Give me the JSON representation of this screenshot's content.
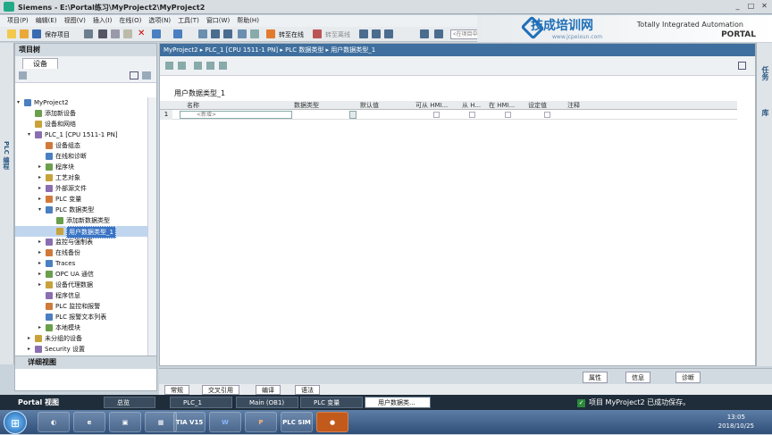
{
  "window": {
    "app": "Siemens",
    "title": "E:\\Portal练习\\MyProject2\\MyProject2"
  },
  "menu": [
    "项目(P)",
    "编辑(E)",
    "视图(V)",
    "插入(I)",
    "在线(O)",
    "选项(N)",
    "工具(T)",
    "窗口(W)",
    "帮助(H)"
  ],
  "toolbar": {
    "save_label": "保存项目",
    "go_online": "转至在线",
    "go_offline": "转至离线",
    "search_placeholder": "<在项目中搜索>"
  },
  "brand": {
    "line1": "Totally Integrated Automation",
    "line2": "PORTAL"
  },
  "watermark": {
    "cn": "技成培训网",
    "url": "www.jcpeixun.com"
  },
  "project_tree": {
    "header": "项目树",
    "tab": "设备",
    "side_label": "PLC 编程",
    "items": [
      {
        "label": "MyProject2",
        "level": 0,
        "arrow": "▾"
      },
      {
        "label": "添加新设备",
        "level": 1,
        "arrow": ""
      },
      {
        "label": "设备和网络",
        "level": 1,
        "arrow": ""
      },
      {
        "label": "PLC_1 [CPU 1511-1 PN]",
        "level": 1,
        "arrow": "▾"
      },
      {
        "label": "设备组态",
        "level": 2,
        "arrow": ""
      },
      {
        "label": "在线和诊断",
        "level": 2,
        "arrow": ""
      },
      {
        "label": "程序块",
        "level": 2,
        "arrow": "▸"
      },
      {
        "label": "工艺对象",
        "level": 2,
        "arrow": "▸"
      },
      {
        "label": "外部源文件",
        "level": 2,
        "arrow": "▸"
      },
      {
        "label": "PLC 变量",
        "level": 2,
        "arrow": "▸"
      },
      {
        "label": "PLC 数据类型",
        "level": 2,
        "arrow": "▾"
      },
      {
        "label": "添加新数据类型",
        "level": 3,
        "arrow": ""
      },
      {
        "label": "用户数据类型_1",
        "level": 3,
        "arrow": "",
        "selected": true
      },
      {
        "label": "监控与强制表",
        "level": 2,
        "arrow": "▸"
      },
      {
        "label": "在线备份",
        "level": 2,
        "arrow": "▸"
      },
      {
        "label": "Traces",
        "level": 2,
        "arrow": "▸"
      },
      {
        "label": "OPC UA 通信",
        "level": 2,
        "arrow": "▸"
      },
      {
        "label": "设备代理数据",
        "level": 2,
        "arrow": "▸"
      },
      {
        "label": "程序信息",
        "level": 2,
        "arrow": ""
      },
      {
        "label": "PLC 监控和报警",
        "level": 2,
        "arrow": ""
      },
      {
        "label": "PLC 报警文本列表",
        "level": 2,
        "arrow": ""
      },
      {
        "label": "本地模块",
        "level": 2,
        "arrow": "▸"
      },
      {
        "label": "未分组的设备",
        "level": 1,
        "arrow": "▸"
      },
      {
        "label": "Security 设置",
        "level": 1,
        "arrow": "▸"
      }
    ]
  },
  "detail_view": {
    "header": "详细视图"
  },
  "editor": {
    "breadcrumb": "MyProject2 ▸ PLC_1 [CPU 1511-1 PN] ▸ PLC 数据类型 ▸ 用户数据类型_1",
    "title": "用户数据类型_1",
    "columns": [
      "名称",
      "数据类型",
      "默认值",
      "可从 HMI...",
      "从 H...",
      "在 HMI...",
      "设定值",
      "注释"
    ],
    "rows": [
      {
        "num": "1",
        "name_placeholder": "<新增>"
      }
    ]
  },
  "right_tabs": [
    "任务",
    "库"
  ],
  "inspector_tabs": [
    "属性",
    "信息",
    "诊断"
  ],
  "general_tabs": [
    "常规",
    "交叉引用",
    "编译",
    "语法"
  ],
  "portal_bar": {
    "portal_view": "Portal 视图",
    "tasks": [
      "总览",
      "PLC_1",
      "Main (OB1)",
      "PLC 变量",
      "用户数据类..."
    ],
    "status": "项目 MyProject2 已成功保存。"
  },
  "taskbar": {
    "time": "13:05",
    "date": "2018/10/25",
    "apps": [
      "TIA V15",
      "W",
      "P",
      "PLC SIM"
    ]
  }
}
